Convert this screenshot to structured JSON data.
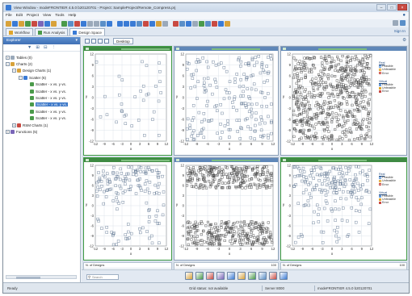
{
  "window": {
    "title": "View Window - modeFRONTIER 4.5.0 b20120701 - Project: SampleProject/Remote_Compress.prj",
    "controls": [
      "–",
      "□",
      "×"
    ]
  },
  "menubar": {
    "items": [
      "File",
      "Edit",
      "Project",
      "View",
      "Tools",
      "Help"
    ],
    "help_icon": "help-icon"
  },
  "toolbar": {
    "icon_colors": [
      "#d8a23a",
      "#3a7bd5",
      "#d8a23a",
      "#4a9a4a",
      "#c94a42",
      "#7a66b8",
      "#3a7bd5",
      "#d8a23a",
      "#4a9a4a",
      "#5a8fc8",
      "#c94a42",
      "#3a7bd5",
      "#9aa9ba",
      "#9aa9ba",
      "#5a8fc8",
      "#3a7bd5",
      "#3a7bd5",
      "#3a7bd5",
      "#3a7bd5",
      "#5a8fc8",
      "#c94a42",
      "#3a7bd5",
      "#d8a23a",
      "#9aa9ba",
      "#c94a42",
      "#5a8fc8",
      "#3a7bd5",
      "#9aa9ba",
      "#4a9a4a",
      "#5a8fc8",
      "#c94a42",
      "#3a7bd5",
      "#d8a23a"
    ]
  },
  "tabs": {
    "items": [
      "Workflow",
      "Run Analysis",
      "Design Space"
    ],
    "active_index": 2,
    "sign_in": "Sign In"
  },
  "sidebar": {
    "title": "Explorer",
    "tree": [
      {
        "label": "Tables (0)",
        "toggle": "+",
        "indent": 0,
        "color": "#9aa9ba"
      },
      {
        "label": "Charts (2)",
        "toggle": "−",
        "indent": 0,
        "color": "#d8a23a"
      },
      {
        "label": "Design Charts (1)",
        "toggle": "−",
        "indent": 1,
        "color": "#d8a23a"
      },
      {
        "label": "Scatter (6)",
        "toggle": "−",
        "indent": 2,
        "color": "#3a7bd5"
      },
      {
        "label": "Scatter - x vs. y vs.",
        "toggle": "",
        "indent": 3,
        "color": "#4a9a4a"
      },
      {
        "label": "Scatter - x vs. y vs.",
        "toggle": "",
        "indent": 3,
        "color": "#4a9a4a"
      },
      {
        "label": "Scatter - x vs. y vs.",
        "toggle": "",
        "indent": 3,
        "color": "#4a9a4a"
      },
      {
        "label": "Scatter - x vs. y vs.",
        "toggle": "",
        "indent": 3,
        "color": "#4a9a4a",
        "selected": true
      },
      {
        "label": "Scatter - x vs. y vs.",
        "toggle": "",
        "indent": 3,
        "color": "#4a9a4a"
      },
      {
        "label": "Scatter - x vs. y vs.",
        "toggle": "",
        "indent": 3,
        "color": "#4a9a4a"
      },
      {
        "label": "RSM Charts (1)",
        "toggle": "+",
        "indent": 1,
        "color": "#c94a42"
      },
      {
        "label": "Functions (5)",
        "toggle": "+",
        "indent": 0,
        "color": "#7a66b8"
      }
    ]
  },
  "desktop": {
    "tab_label": "Desktop"
  },
  "charts": {
    "axis_ticks": [
      "-12",
      "-9",
      "-6",
      "-3",
      "0",
      "3",
      "6",
      "9",
      "12"
    ],
    "x_label": "x",
    "y_label": "y",
    "legend_top": {
      "title": "Real",
      "items": [
        "Feasible",
        "Unfeasible",
        "Error"
      ]
    },
    "legend_bottom": {
      "title": "Virtual",
      "items": [
        "Feasible",
        "Unfeasible",
        "Error"
      ]
    }
  },
  "info_tables": [
    {
      "rows": [
        [
          "N. of Designs",
          ""
        ],
        [
          "5 Bits",
          ""
        ]
      ]
    },
    {
      "rows": [
        [
          "N. of Designs",
          "100"
        ],
        [
          "4 Bits",
          "+4"
        ],
        [
          "3 Bits",
          "+2"
        ]
      ]
    },
    {
      "rows": [
        [
          "N. of Designs",
          "100"
        ],
        [
          "3 Bits",
          "+0"
        ],
        [
          "4 Bits",
          "+2"
        ]
      ]
    }
  ],
  "bottom": {
    "search_placeholder": "Search",
    "chart_icon_colors": [
      "#d8a23a",
      "#4a9a4a",
      "#c94a42",
      "#7a66b8",
      "#3a7bd5",
      "#d8a23a",
      "#4a9a4a",
      "#5a8fc8",
      "#c94a42",
      "#3a7bd5"
    ]
  },
  "status": {
    "ready": "Ready",
    "message": "Grid status: not available",
    "cell_user": "Server 8000",
    "cell_version": "modeFRONTIER 4.5.0 b20120701"
  }
}
